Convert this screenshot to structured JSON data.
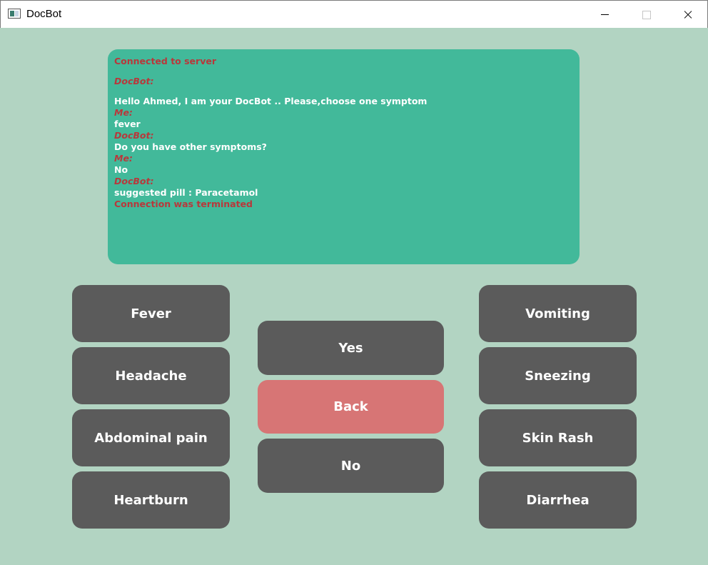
{
  "window": {
    "title": "DocBot"
  },
  "chat": {
    "status_connected": "Connected to server",
    "messages": [
      {
        "sender": "DocBot:",
        "text": "Hello Ahmed, I am your DocBot .. Please,choose one symptom"
      },
      {
        "sender": "Me:",
        "text": "fever"
      },
      {
        "sender": "DocBot:",
        "text": "Do you have other symptoms?"
      },
      {
        "sender": "Me:",
        "text": "No"
      },
      {
        "sender": "DocBot:",
        "text": "suggested pill : Paracetamol"
      }
    ],
    "status_terminated": "Connection was terminated"
  },
  "symptoms_left": [
    "Fever",
    "Headache",
    "Abdominal pain",
    "Heartburn"
  ],
  "symptoms_right": [
    "Vomiting",
    "Sneezing",
    "Skin Rash",
    "Diarrhea"
  ],
  "controls": {
    "yes": "Yes",
    "back": "Back",
    "no": "No"
  },
  "colors": {
    "background": "#b2d4c2",
    "chat_panel": "#42b99a",
    "button": "#5b5b5b",
    "back_button": "#d77575",
    "sender_text": "#b8383b"
  }
}
